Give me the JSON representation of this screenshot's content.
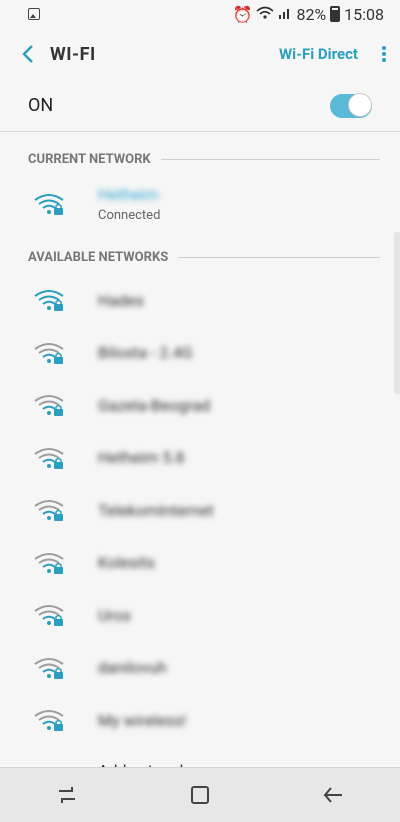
{
  "statusbar": {
    "battery": "82%",
    "time": "15:08"
  },
  "appbar": {
    "title": "WI-FI",
    "wifi_direct": "Wi-Fi Direct"
  },
  "onrow": {
    "label": "ON",
    "enabled": true
  },
  "sections": {
    "current": "CURRENT NETWORK",
    "available": "AVAILABLE NETWORKS"
  },
  "current_network": {
    "name": "Hetheim",
    "status": "Connected"
  },
  "networks": [
    {
      "name": "Hades",
      "strong": true
    },
    {
      "name": "Bilosta - 2.4G",
      "strong": false
    },
    {
      "name": "Gazela-Beograd",
      "strong": false
    },
    {
      "name": "Hetheim 5.8",
      "strong": false
    },
    {
      "name": "TelekomInternet",
      "strong": false
    },
    {
      "name": "Kolesits",
      "strong": false
    },
    {
      "name": "Uros",
      "strong": false
    },
    {
      "name": "danilovuh",
      "strong": false
    },
    {
      "name": "My wireless!",
      "strong": false
    }
  ],
  "add_network": "Add network",
  "colors": {
    "accent": "#2b9fc0",
    "toggle": "#5ab9d7"
  }
}
